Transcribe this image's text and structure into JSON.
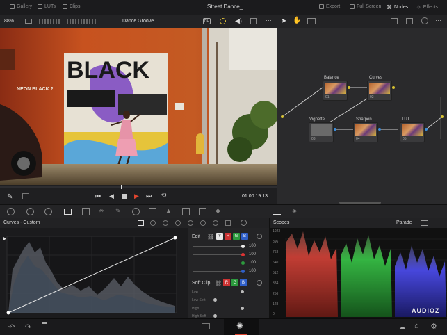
{
  "top": {
    "gallery": "Gallery",
    "luts": "LUTs",
    "clips": "Clips",
    "title": "Street Dance_",
    "export": "Export",
    "fullscreen": "Full Screen",
    "nodes": "Nodes",
    "effects": "Effects"
  },
  "viewer": {
    "zoom": "88%",
    "clip_name": "Dance Groove",
    "timecode": "01:00:19:13",
    "mural_text": "BLACK",
    "sign_text": "NEON BLACK 2"
  },
  "nodes": [
    {
      "label": "Balance",
      "id": "01"
    },
    {
      "label": "Curves",
      "id": "02"
    },
    {
      "label": "Vignette",
      "id": "03"
    },
    {
      "label": "Sharpen",
      "id": "04"
    },
    {
      "label": "LUT",
      "id": "05"
    }
  ],
  "curves": {
    "title": "Curves - Custom"
  },
  "edit": {
    "title": "Edit",
    "channels": [
      "Y",
      "R",
      "G",
      "B"
    ],
    "values": [
      "100",
      "100",
      "100",
      "100"
    ],
    "soft_clip": "Soft Clip",
    "soft_clip_rows": [
      "Low",
      "Low Soft",
      "High",
      "High Soft"
    ]
  },
  "scopes": {
    "title": "Scopes",
    "mode": "Parade",
    "scale": [
      "1023",
      "896",
      "768",
      "640",
      "512",
      "384",
      "256",
      "128",
      "0"
    ],
    "watermark": "AUDIOZ"
  },
  "colors": {
    "accent_red": "#e0452f",
    "yellow_dot": "#d7c232",
    "blue_dot": "#3a8fe0"
  }
}
